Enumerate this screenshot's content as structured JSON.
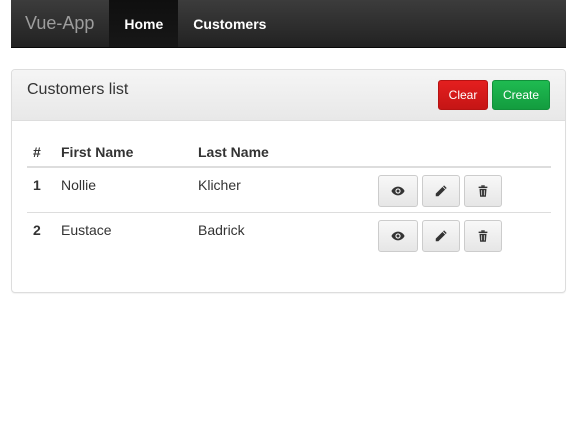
{
  "navbar": {
    "brand": "Vue-App",
    "links": [
      {
        "label": "Home",
        "active": true
      },
      {
        "label": "Customers",
        "active": false
      }
    ]
  },
  "panel": {
    "title": "Customers list",
    "buttons": {
      "clear": "Clear",
      "create": "Create"
    }
  },
  "table": {
    "headers": [
      "#",
      "First Name",
      "Last Name",
      ""
    ],
    "rows": [
      {
        "num": "1",
        "first": "Nollie",
        "last": "Klicher"
      },
      {
        "num": "2",
        "first": "Eustace",
        "last": "Badrick"
      }
    ],
    "row_actions": [
      "eye-icon",
      "pencil-icon",
      "trash-icon"
    ]
  },
  "colors": {
    "clear": "#d9161b",
    "create": "#16a846",
    "navbar": "#2b2b2b"
  }
}
